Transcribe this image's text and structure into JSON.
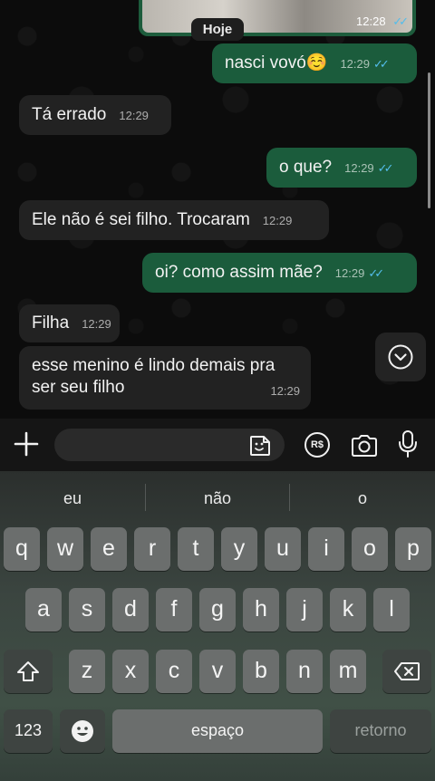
{
  "chat": {
    "image_message": {
      "time": "12:28",
      "ticks": "✓✓"
    },
    "date_chip": "Hoje",
    "messages": [
      {
        "text": "nasci vovó☺️",
        "time": "12:29",
        "ticks": "✓✓",
        "direction": "out"
      },
      {
        "text": "Tá errado",
        "time": "12:29",
        "direction": "in"
      },
      {
        "text": "o que?",
        "time": "12:29",
        "ticks": "✓✓",
        "direction": "out"
      },
      {
        "text": "Ele não é sei filho. Trocaram",
        "time": "12:29",
        "direction": "in"
      },
      {
        "text": "oi? como assim mãe?",
        "time": "12:29",
        "ticks": "✓✓",
        "direction": "out"
      },
      {
        "text": "Filha",
        "time": "12:29",
        "direction": "in"
      },
      {
        "text": "esse menino é lindo demais pra ser seu filho",
        "time": "12:29",
        "direction": "in"
      }
    ]
  },
  "input": {
    "value": "",
    "icons": [
      "plus-icon",
      "sticker-icon",
      "payment-icon",
      "camera-icon",
      "microphone-icon"
    ],
    "payment_label": "R$"
  },
  "keyboard": {
    "suggestions": [
      "eu",
      "não",
      "o"
    ],
    "row1": [
      "q",
      "w",
      "e",
      "r",
      "t",
      "y",
      "u",
      "i",
      "o",
      "p"
    ],
    "row2": [
      "a",
      "s",
      "d",
      "f",
      "g",
      "h",
      "j",
      "k",
      "l"
    ],
    "row3": [
      "z",
      "x",
      "c",
      "v",
      "b",
      "n",
      "m"
    ],
    "numbers_key": "123",
    "space_key": "espaço",
    "return_key": "retorno"
  },
  "colors": {
    "outgoing_bubble": "#1b5c3c",
    "incoming_bubble": "#222222",
    "read_ticks": "#53bdeb"
  }
}
